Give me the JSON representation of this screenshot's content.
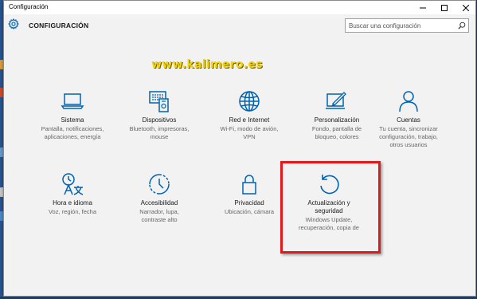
{
  "window": {
    "title": "Configuración"
  },
  "header": {
    "title": "CONFIGURACIÓN"
  },
  "search": {
    "placeholder": "Buscar una configuración"
  },
  "watermark": "www.kalimero.es",
  "colors": {
    "accent": "#0063b1",
    "highlight": "#e01a1a",
    "watermark": "#f4d40a"
  },
  "tiles": [
    {
      "title": "Sistema",
      "icon": "laptop-icon",
      "desc": [
        "Pantalla, notificaciones,",
        "aplicaciones, energía"
      ]
    },
    {
      "title": "Dispositivos",
      "icon": "devices-icon",
      "desc": [
        "Bluetooth, impresoras,",
        "mouse"
      ]
    },
    {
      "title": "Red e Internet",
      "icon": "globe-icon",
      "desc": [
        "Wi-Fi, modo de avión,",
        "VPN"
      ]
    },
    {
      "title": "Personalización",
      "icon": "personalization-icon",
      "desc": [
        "Fondo, pantalla de",
        "bloqueo, colores"
      ]
    },
    {
      "title": "Cuentas",
      "icon": "person-icon",
      "desc": [
        "Tu cuenta, sincronizar",
        "configuración, trabajo,",
        "otros usuarios"
      ]
    },
    {
      "title": "Hora e idioma",
      "icon": "time-language-icon",
      "desc": [
        "Voz, región, fecha"
      ]
    },
    {
      "title": "Accesibilidad",
      "icon": "ease-of-access-icon",
      "desc": [
        "Narrador, lupa,",
        "contraste alto"
      ]
    },
    {
      "title": "Privacidad",
      "icon": "lock-icon",
      "desc": [
        "Ubicación, cámara"
      ]
    },
    {
      "title": [
        "Actualización y",
        "seguridad"
      ],
      "icon": "update-icon",
      "desc": [
        "Windows Update,",
        "recuperación, copia de"
      ]
    }
  ]
}
